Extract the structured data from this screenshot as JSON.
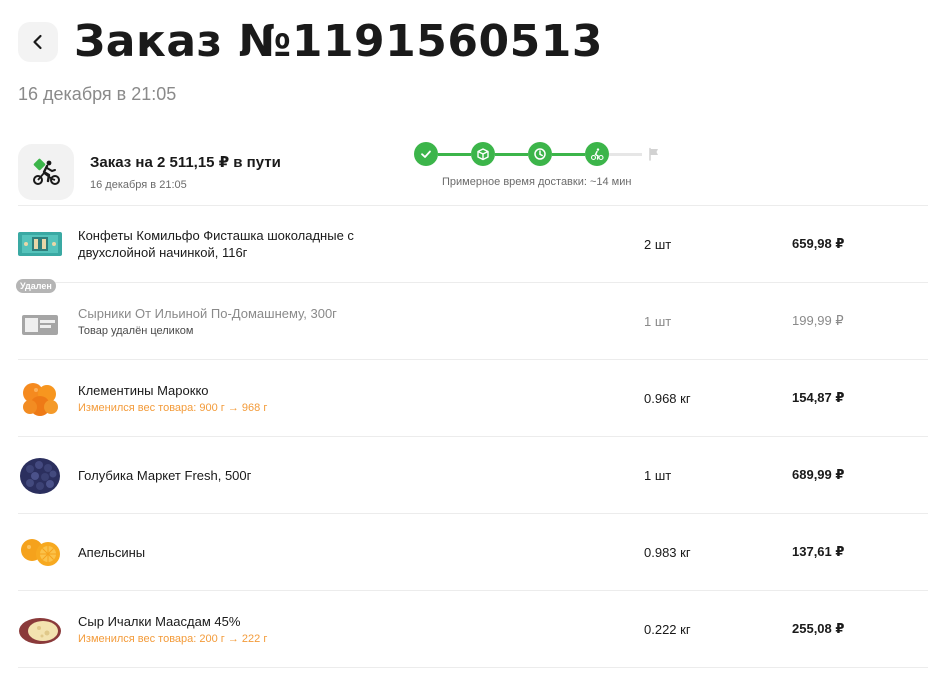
{
  "header": {
    "title": "Заказ №1191560513",
    "date": "16 декабря в 21:05"
  },
  "status": {
    "title": "Заказ на 2 511,15 ₽ в пути",
    "date": "16 декабря в 21:05",
    "eta": "Примерное время доставки: ~14 мин",
    "steps": [
      "check-icon",
      "box-icon",
      "clock-icon",
      "courier-icon",
      "flag-icon"
    ],
    "accent": "#3cb54a"
  },
  "items": [
    {
      "name": "Конфеты Комильфо Фисташка шоколадные с двухслойной начинкой, 116г",
      "note": "",
      "qty": "2 шт",
      "price": "659,98 ₽"
    },
    {
      "name": "Сырники От Ильиной По-Домашнему, 300г",
      "note": "Товар удалён целиком",
      "badge": "Удален",
      "qty": "1 шт",
      "price": "199,99 ₽"
    },
    {
      "name": "Клементины Марокко",
      "note": "Изменился вес товара: 900 г → 968 г",
      "qty": "0.968 кг",
      "price": "154,87 ₽"
    },
    {
      "name": "Голубика Маркет Fresh, 500г",
      "note": "",
      "qty": "1 шт",
      "price": "689,99 ₽"
    },
    {
      "name": "Апельсины",
      "note": "",
      "qty": "0.983 кг",
      "price": "137,61 ₽"
    },
    {
      "name": "Сыр Ичалки Маасдам 45%",
      "note": "Изменился вес товара: 200 г → 222 г",
      "qty": "0.222 кг",
      "price": "255,08 ₽"
    }
  ],
  "colors": {
    "orange_note": "#f39b3a",
    "muted": "#8a8a8a"
  }
}
